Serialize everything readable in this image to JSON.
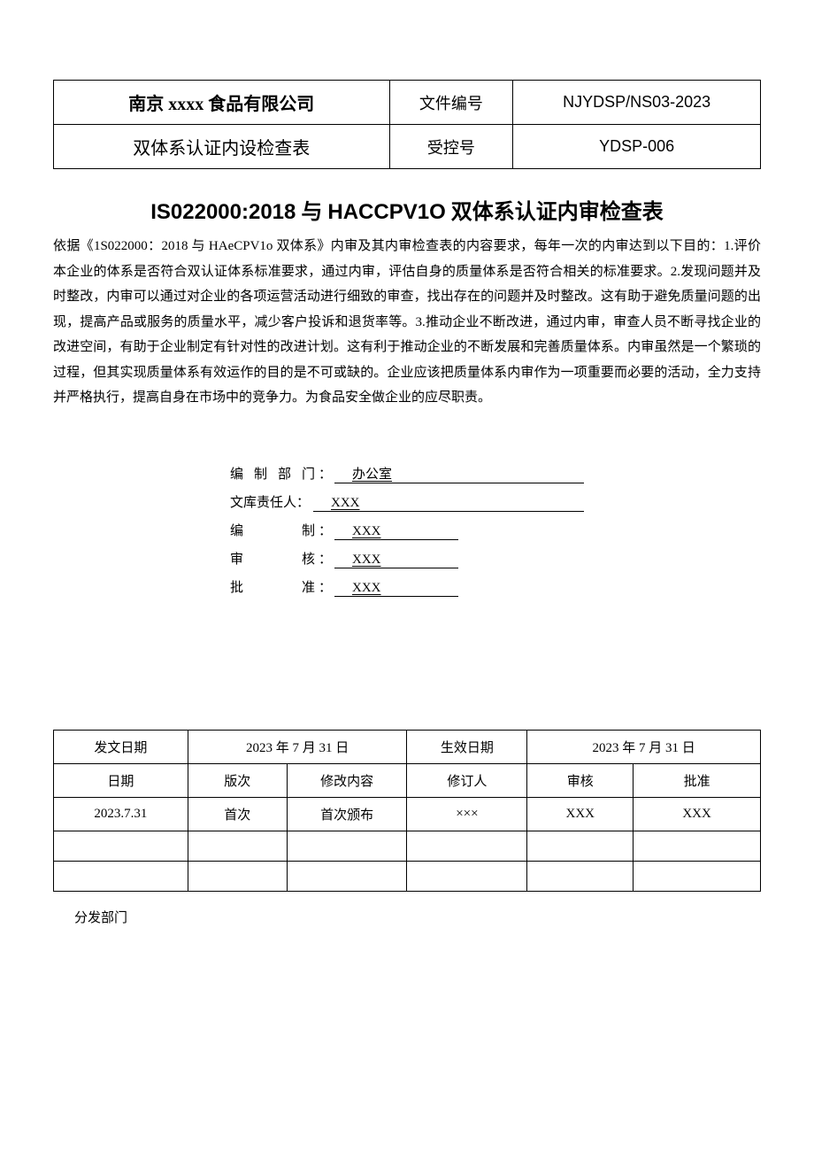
{
  "header": {
    "company": "南京 xxxx 食品有限公司",
    "doc_no_label": "文件编号",
    "doc_no_value": "NJYDSP/NS03-2023",
    "subtitle": "双体系认证内设检查表",
    "controlled_label": "受控号",
    "controlled_value": "YDSP-006"
  },
  "title": {
    "iso": "IS022000:2018",
    "join": " 与 ",
    "haccp": "HACCPV1O",
    "rest": " 双体系认证内审检查表"
  },
  "intro": "依据《1S022000：2018 与 HAeCPV1o 双体系》内审及其内审检查表的内容要求，每年一次的内审达到以下目的：1.评价本企业的体系是否符合双认证体系标准要求，通过内审，评估自身的质量体系是否符合相关的标准要求。2.发现问题并及时整改，内审可以通过对企业的各项运营活动进行细致的审查，找出存在的问题并及时整改。这有助于避免质量问题的出现，提高产品或服务的质量水平，减少客户投诉和退货率等。3.推动企业不断改进，通过内审，审查人员不断寻找企业的改进空间，有助于企业制定有针对性的改进计划。这有利于推动企业的不断发展和完善质量体系。内审虽然是一个繁琐的过程，但其实现质量体系有效运作的目的是不可或缺的。企业应该把质量体系内审作为一项重要而必要的活动，全力支持并严格执行，提高自身在市场中的竞争力。为食品安全做企业的应尽职责。",
  "sign": {
    "dept_label": "编制部门",
    "dept_value": "办公室",
    "owner_label": "文库责任人：",
    "owner_value": "XXX",
    "edit_label": "编　　制",
    "edit_value": "XXX",
    "review_label": "审　　核",
    "review_value": "XXX",
    "approve_label": "批　　准",
    "approve_value": "XXX"
  },
  "dates": {
    "issue_label": "发文日期",
    "issue_value": "2023 年 7 月 31 日",
    "effective_label": "生效日期",
    "effective_value": "2023 年 7 月 31 日"
  },
  "rev_headers": [
    "日期",
    "版次",
    "修改内容",
    "修订人",
    "审核",
    "批准"
  ],
  "rev_rows": [
    [
      "2023.7.31",
      "首次",
      "首次颁布",
      "×××",
      "XXX",
      "XXX"
    ],
    [
      "",
      "",
      "",
      "",
      "",
      ""
    ],
    [
      "",
      "",
      "",
      "",
      "",
      ""
    ]
  ],
  "distribution_label": "分发部门"
}
